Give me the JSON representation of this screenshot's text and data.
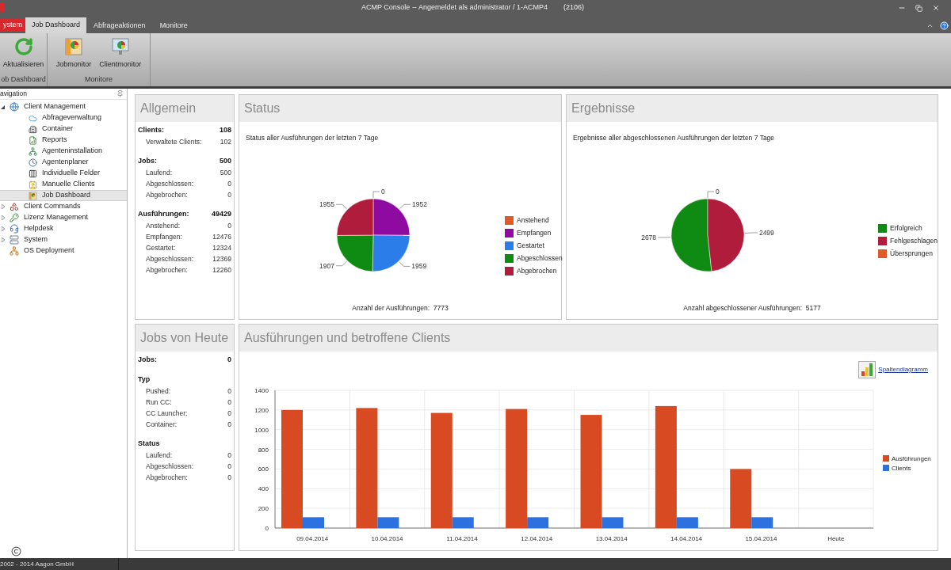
{
  "window": {
    "title": "ACMP Console -- Angemeldet als administrator / 1-ACMP4",
    "session": "(2106)"
  },
  "ribbon": {
    "tabs": [
      {
        "label": "ystem",
        "kind": "app-menu",
        "selected": false
      },
      {
        "label": "Job Dashboard",
        "kind": "tab",
        "selected": true
      },
      {
        "label": "Abfrageaktionen",
        "kind": "tab",
        "selected": false
      },
      {
        "label": "Monitore",
        "kind": "tab",
        "selected": false
      }
    ],
    "groups": [
      {
        "label": "ob Dashboard",
        "buttons": [
          "Aktualisieren"
        ]
      },
      {
        "label": "Monitore",
        "buttons": [
          "Jobmonitor",
          "Clientmonitor"
        ]
      }
    ]
  },
  "navigation": {
    "title": "avigation",
    "items": [
      {
        "label": "Client Management",
        "expanded": true,
        "selected": false,
        "children": [
          {
            "label": "Abfrageverwaltung",
            "selected": false
          },
          {
            "label": "Container",
            "selected": false
          },
          {
            "label": "Reports",
            "selected": false
          },
          {
            "label": "Agenteninstallation",
            "selected": false
          },
          {
            "label": "Agentenplaner",
            "selected": false
          },
          {
            "label": "Individuelle Felder",
            "selected": false
          },
          {
            "label": "Manuelle Clients",
            "selected": false
          },
          {
            "label": "Job Dashboard",
            "selected": true
          }
        ]
      },
      {
        "label": "Client Commands",
        "expanded": false,
        "selected": false
      },
      {
        "label": "Lizenz Management",
        "expanded": false,
        "selected": false
      },
      {
        "label": "Helpdesk",
        "expanded": false,
        "selected": false
      },
      {
        "label": "System",
        "expanded": false,
        "selected": false
      },
      {
        "label": "OS Deployment",
        "selected": false
      }
    ]
  },
  "general": {
    "title": "Allgemein",
    "sections": [
      {
        "label": "Clients:",
        "value": "108",
        "rows": [
          {
            "label": "Verwaltete Clients:",
            "value": "102"
          }
        ]
      },
      {
        "label": "Jobs:",
        "value": "500",
        "rows": [
          {
            "label": "Laufend:",
            "value": "500"
          },
          {
            "label": "Abgeschlossen:",
            "value": "0"
          },
          {
            "label": "Abgebrochen:",
            "value": "0"
          }
        ]
      },
      {
        "label": "Ausführungen:",
        "value": "49429",
        "rows": [
          {
            "label": "Anstehend:",
            "value": "0"
          },
          {
            "label": "Empfangen:",
            "value": "12476"
          },
          {
            "label": "Gestartet:",
            "value": "12324"
          },
          {
            "label": "Abgeschlossen:",
            "value": "12369"
          },
          {
            "label": "Abgebrochen:",
            "value": "12260"
          }
        ]
      }
    ]
  },
  "status": {
    "title": "Status",
    "subtitle": "Status aller Ausführungen der letzten 7 Tage",
    "chart_data": {
      "type": "pie",
      "categories": [
        "Anstehend",
        "Empfangen",
        "Gestartet",
        "Abgeschlossen",
        "Abgebrochen"
      ],
      "values": [
        0,
        1952,
        1959,
        1907,
        1955
      ],
      "value_labels": [
        "0",
        "1952",
        "1959",
        "1907",
        "1955"
      ],
      "colors": [
        "#e05a28",
        "#8e0aa0",
        "#2b7de9",
        "#0f8a12",
        "#b01c3c"
      ],
      "legend": "right"
    },
    "total": "Anzahl der Ausführungen:  7773"
  },
  "results": {
    "title": "Ergebnisse",
    "subtitle": "Ergebnisse aller abgeschlossenen Ausführungen der letzten 7 Tage",
    "chart_data": {
      "type": "pie",
      "categories": [
        "Erfolgreich",
        "Fehlgeschlagen",
        "Übersprungen"
      ],
      "values": [
        2678,
        2499,
        0
      ],
      "value_labels": [
        "2678",
        "2499",
        "0"
      ],
      "colors": [
        "#0f8a12",
        "#b01c3c",
        "#e05a28"
      ],
      "legend": "right"
    },
    "total": "Anzahl abgeschlossener Ausführungen:  5177"
  },
  "jobs_today": {
    "title": "Jobs von Heute",
    "sections": [
      {
        "label": "Jobs:",
        "value": "0"
      },
      {
        "label": "Typ",
        "rows": [
          {
            "label": "Pushed:",
            "value": "0"
          },
          {
            "label": "Run CC:",
            "value": "0"
          },
          {
            "label": "CC Launcher:",
            "value": "0"
          },
          {
            "label": "Container:",
            "value": "0"
          }
        ]
      },
      {
        "label": "Status",
        "rows": [
          {
            "label": "Laufend:",
            "value": "0"
          },
          {
            "label": "Abgeschlossen:",
            "value": "0"
          },
          {
            "label": "Abgebrochen:",
            "value": "0"
          }
        ]
      }
    ]
  },
  "executions": {
    "title": "Ausführungen und betroffene Clients",
    "link": "Spaltendiagramm",
    "chart_data": {
      "type": "bar",
      "categories": [
        "09.04.2014",
        "10.04.2014",
        "11.04.2014",
        "12.04.2014",
        "13.04.2014",
        "14.04.2014",
        "15.04.2014",
        "Heute"
      ],
      "series": [
        {
          "name": "Ausführungen",
          "color": "#d84a22",
          "values": [
            1200,
            1220,
            1170,
            1210,
            1150,
            1240,
            600,
            null
          ]
        },
        {
          "name": "Clients",
          "color": "#2b72e0",
          "values": [
            110,
            110,
            110,
            110,
            110,
            110,
            110,
            null
          ]
        }
      ],
      "ylim": [
        0,
        1400
      ],
      "yticks": [
        0,
        200,
        400,
        600,
        800,
        1000,
        1200,
        1400
      ],
      "grid": true,
      "legend": "right"
    }
  },
  "status_bar": {
    "text": "2002 - 2014 Aagon GmbH"
  }
}
